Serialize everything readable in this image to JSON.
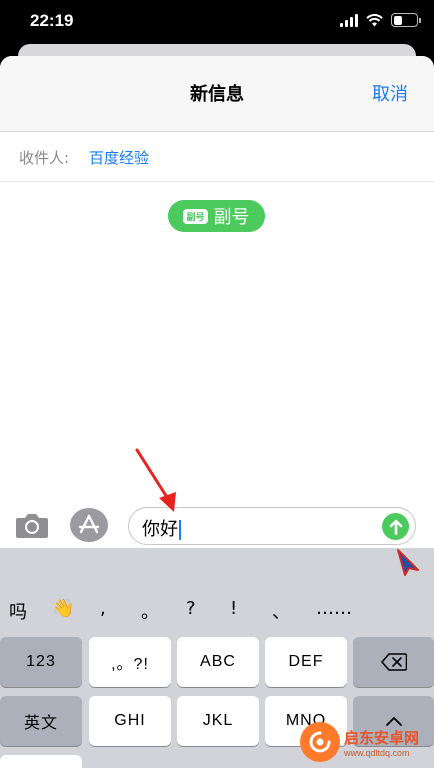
{
  "status_bar": {
    "time": "22:19",
    "battery_level": 0.38
  },
  "nav": {
    "title": "新信息",
    "cancel_label": "取消"
  },
  "recipient": {
    "label": "收件人:",
    "name": "百度经验"
  },
  "line_selector": {
    "badge": "副号",
    "label": "副号"
  },
  "composer": {
    "text": "你好"
  },
  "keyboard": {
    "candidates": [
      "吗",
      "👋",
      ",",
      "。",
      "?",
      "!",
      "、",
      "……"
    ],
    "keys": {
      "numbers": "123",
      "punct": ",。?!",
      "abc": "ABC",
      "def": "DEF",
      "english": "英文",
      "ghi": "GHI",
      "jkl": "JKL",
      "mno": "MNO"
    }
  },
  "watermark": {
    "title": "启东安卓网",
    "url": "www.qdltdq.com"
  },
  "colors": {
    "accent_blue": "#1a7cf5",
    "imessage_green": "#4cca5d",
    "keyboard_bg": "#d1d3d9"
  }
}
